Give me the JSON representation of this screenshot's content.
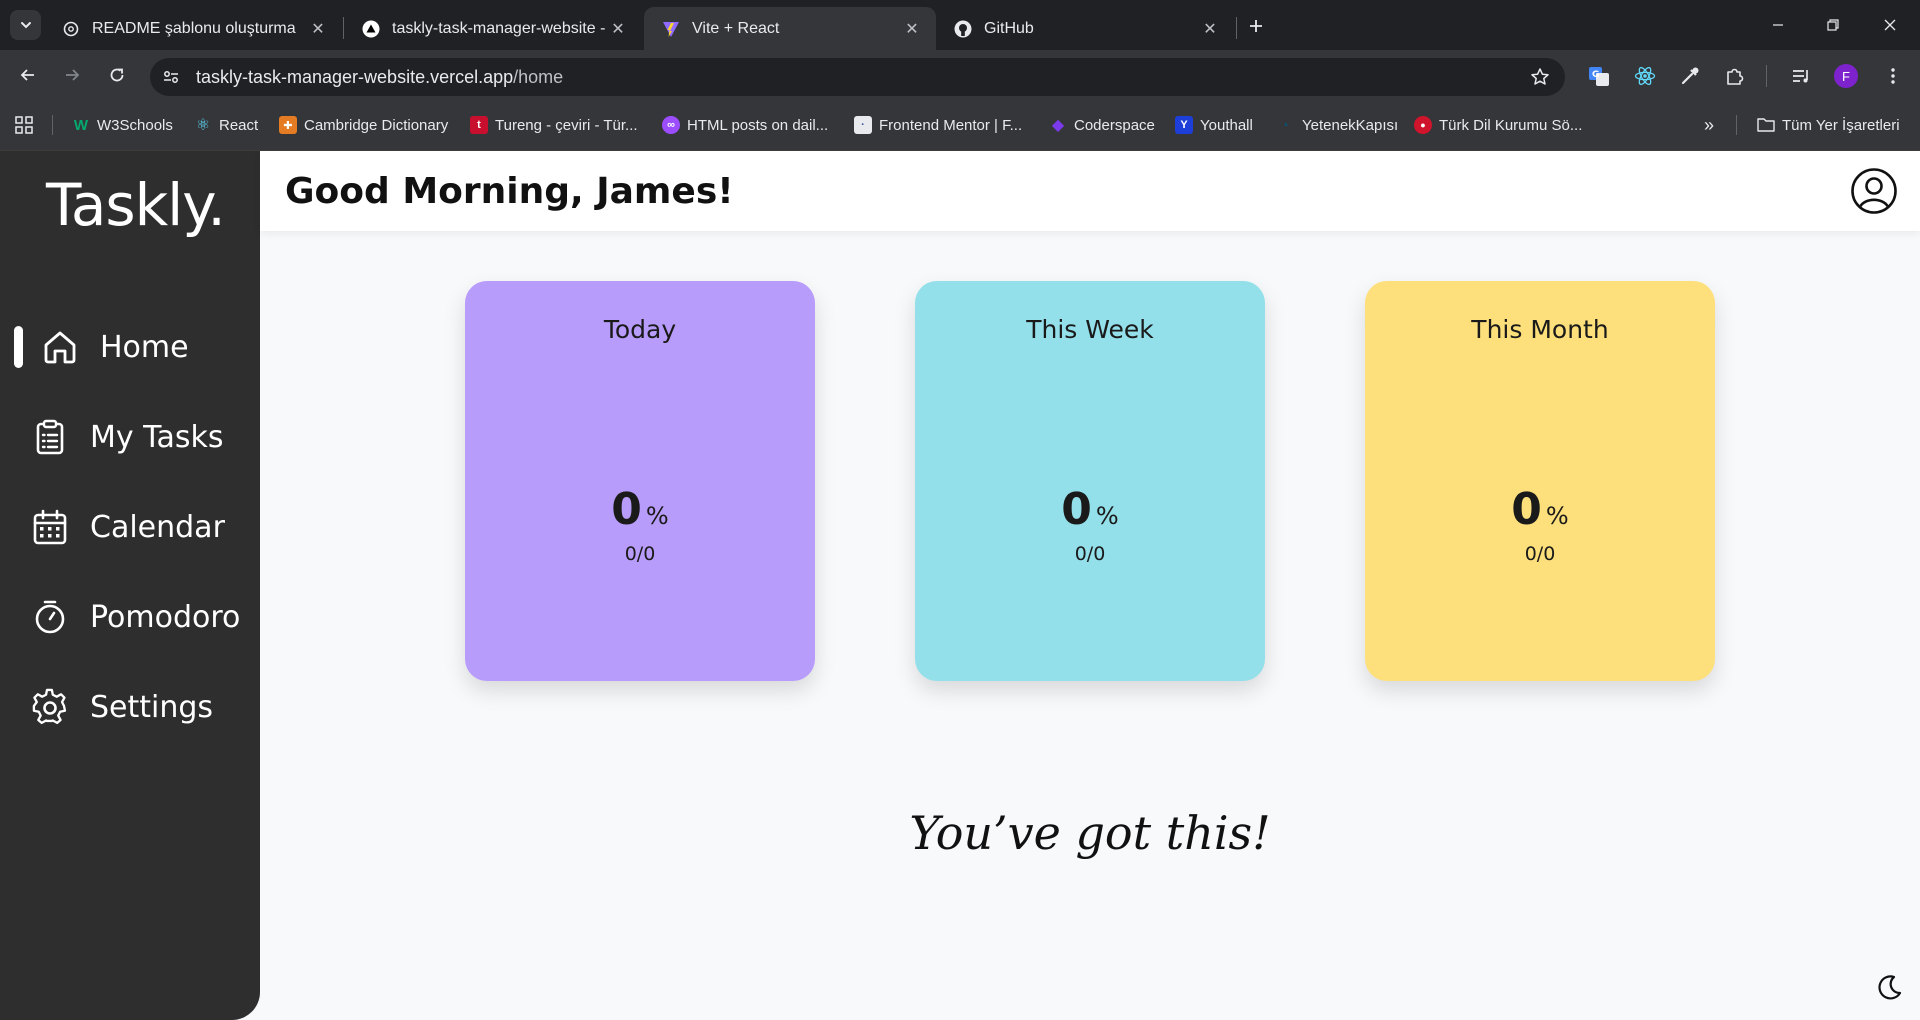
{
  "browser": {
    "tabs": [
      {
        "title": "README şablonu oluşturma",
        "icon": "openai-icon",
        "active": false
      },
      {
        "title": "taskly-task-manager-website - ",
        "icon": "vercel-icon",
        "active": false
      },
      {
        "title": "Vite + React",
        "icon": "vite-icon",
        "active": true
      },
      {
        "title": "GitHub",
        "icon": "github-icon",
        "active": false
      }
    ],
    "url_host": "taskly-task-manager-website.vercel.app",
    "url_path": "/home",
    "profile_initial": "F",
    "bookmarks": [
      {
        "label": "W3Schools",
        "color": "#04aa6d",
        "glyph": "W"
      },
      {
        "label": "React",
        "color": "#61dafb",
        "glyph": "⚛"
      },
      {
        "label": "Cambridge Dictionary",
        "color": "#e57c23",
        "glyph": "✚"
      },
      {
        "label": "Tureng - çeviri - Tür...",
        "color": "#c8102e",
        "glyph": "t"
      },
      {
        "label": "HTML posts on dail...",
        "color": "#9b4dff",
        "glyph": "∞"
      },
      {
        "label": "Frontend Mentor | F...",
        "color": "#e8eaed",
        "glyph": "·"
      },
      {
        "label": "Coderspace",
        "color": "#6c2bd9",
        "glyph": "◆"
      },
      {
        "label": "Youthall",
        "color": "#1d3ed8",
        "glyph": "Y"
      },
      {
        "label": "YetenekKapısı",
        "color": "#0b4f6c",
        "glyph": "▪"
      },
      {
        "label": "Türk Dil Kurumu Sö...",
        "color": "#d0142b",
        "glyph": "●"
      }
    ],
    "all_bookmarks_label": "Tüm Yer İşaretleri"
  },
  "app": {
    "logo": "Taskly.",
    "greeting": "Good Morning, James!",
    "nav": [
      {
        "label": "Home",
        "icon": "home-icon",
        "active": true
      },
      {
        "label": "My Tasks",
        "icon": "clipboard-icon",
        "active": false
      },
      {
        "label": "Calendar",
        "icon": "calendar-icon",
        "active": false
      },
      {
        "label": "Pomodoro",
        "icon": "timer-icon",
        "active": false
      },
      {
        "label": "Settings",
        "icon": "gear-icon",
        "active": false
      }
    ],
    "cards": [
      {
        "title": "Today",
        "percent": "0",
        "percent_sign": "%",
        "count": "0/0",
        "color": "#b89cfb"
      },
      {
        "title": "This Week",
        "percent": "0",
        "percent_sign": "%",
        "count": "0/0",
        "color": "#93dfea"
      },
      {
        "title": "This Month",
        "percent": "0",
        "percent_sign": "%",
        "count": "0/0",
        "color": "#fde07b"
      }
    ],
    "quote": "You’ve got this!"
  }
}
